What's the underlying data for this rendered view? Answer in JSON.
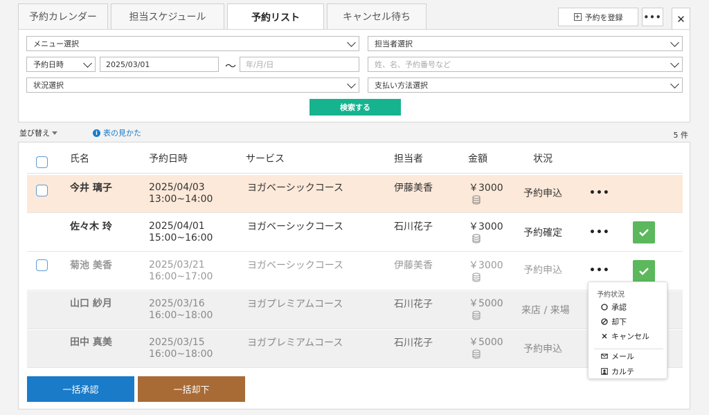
{
  "tabs": [
    "予約カレンダー",
    "担当スケジュール",
    "予約リスト",
    "キャンセル待ち"
  ],
  "actions": {
    "register": "予約を登録",
    "more": "•••",
    "close": "✕"
  },
  "filters": {
    "menu": "メニュー選択",
    "staff": "担当者選択",
    "date_type": "予約日時",
    "date_from": "2025/03/01",
    "tilde": "〜",
    "date_to_placeholder": "年/月/日",
    "keyword_placeholder": "姓、名、予約番号など",
    "status": "状況選択",
    "payment": "支払い方法選択",
    "search": "検索する"
  },
  "toolbar": {
    "sort": "並び替え",
    "howto": "表の見かた",
    "info": "i",
    "count": "5 件"
  },
  "columns": [
    "氏名",
    "予約日時",
    "サービス",
    "担当者",
    "金額",
    "状況"
  ],
  "rows": [
    {
      "name": "今井 璃子",
      "date": "2025/04/03",
      "time": "13:00~14:00",
      "service": "ヨガベーシックコース",
      "staff": "伊藤美香",
      "price": "￥3000",
      "status": "予約申込",
      "more": "•••"
    },
    {
      "name": "佐々木 玲",
      "date": "2025/04/01",
      "time": "15:00~16:00",
      "service": "ヨガベーシックコース",
      "staff": "石川花子",
      "price": "￥3000",
      "status": "予約確定",
      "more": "•••"
    },
    {
      "name": "菊池 美香",
      "date": "2025/03/21",
      "time": "16:00~17:00",
      "service": "ヨガベーシックコース",
      "staff": "伊藤美香",
      "price": "￥3000",
      "status": "予約申込",
      "more": "•••"
    },
    {
      "name": "山口 紗月",
      "date": "2025/03/16",
      "time": "16:00~18:00",
      "service": "ヨガプレミアムコース",
      "staff": "石川花子",
      "price": "￥5000",
      "status": "来店 / 来場"
    },
    {
      "name": "田中 真美",
      "date": "2025/03/15",
      "time": "16:00~18:00",
      "service": "ヨガプレミアムコース",
      "staff": "石川花子",
      "price": "￥5000",
      "status": "予約申込"
    }
  ],
  "bulk": {
    "approve": "一括承認",
    "reject": "一括却下"
  },
  "popup": {
    "title": "予約状況",
    "approve": "承認",
    "reject": "却下",
    "cancel": "キャンセル",
    "mail": "メール",
    "chart": "カルテ"
  },
  "colors": {
    "highlight_row": "#fce9d9",
    "muted_row": "#f0f0f0",
    "accent_green": "#16b38f",
    "approve_blue": "#1a7bc9",
    "reject_brown": "#a86b36",
    "check_green": "#5cb85c"
  }
}
